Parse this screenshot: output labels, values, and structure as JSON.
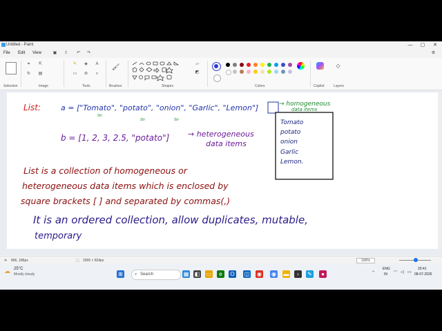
{
  "window": {
    "title": "Untitled - Paint"
  },
  "menu": {
    "file": "File",
    "edit": "Edit",
    "view": "View"
  },
  "ribbon": {
    "selection": "Selection",
    "image": "Image",
    "tools": "Tools",
    "brushes": "Brushes",
    "shapes": "Shapes",
    "colors": "Colors",
    "copilot": "Copilot",
    "layers": "Layers",
    "swatches": [
      "#000000",
      "#7f7f7f",
      "#880015",
      "#ed1c24",
      "#ff7f27",
      "#fff200",
      "#22b14c",
      "#00a2e8",
      "#3f48cc",
      "#a349a4",
      "#ffffff",
      "#c3c3c3",
      "#b97a57",
      "#ffaec9",
      "#ffc90e",
      "#efe4b0",
      "#b5e61d",
      "#99d9ea",
      "#7092be",
      "#c8bfe7"
    ],
    "accent": "#2e3bd1"
  },
  "canvas": {
    "list_label": "List:",
    "a_line": "a = [\"Tomato\", \"potato\", \"onion\", \"Garlic\", \"Lemon\"]",
    "str_marks": [
      "Str",
      "Str",
      "Str"
    ],
    "homogeneous_note": "→ homogeneous",
    "homogeneous_sub": "data items",
    "list_items": [
      "Tomato",
      "potato",
      "onion",
      "Garlic",
      "Lemon."
    ],
    "b_line": "b = [1, 2, 3, 2.5, \"potato\"]",
    "heterogeneous_note": "→ heterogeneous",
    "heterogeneous_sub": "data items",
    "def_line1": "List is a collection of homogeneous or",
    "def_line2": "heterogeneous data items which is enclosed by",
    "def_line3": "square brackets [ ] and separated by commas(,)",
    "prop_line1": "It is an ordered collection, allow duplicates, mutable,",
    "prop_line2": "temporary"
  },
  "status": {
    "cursor": "806, 186px",
    "size": "2005 × 824px",
    "zoom": "100%"
  },
  "taskbar": {
    "weather_temp": "25°C",
    "weather_desc": "Mostly cloudy",
    "search": "Search",
    "lang": "ENG",
    "region": "IN",
    "time": "20:41",
    "date": "08-07-2026"
  }
}
